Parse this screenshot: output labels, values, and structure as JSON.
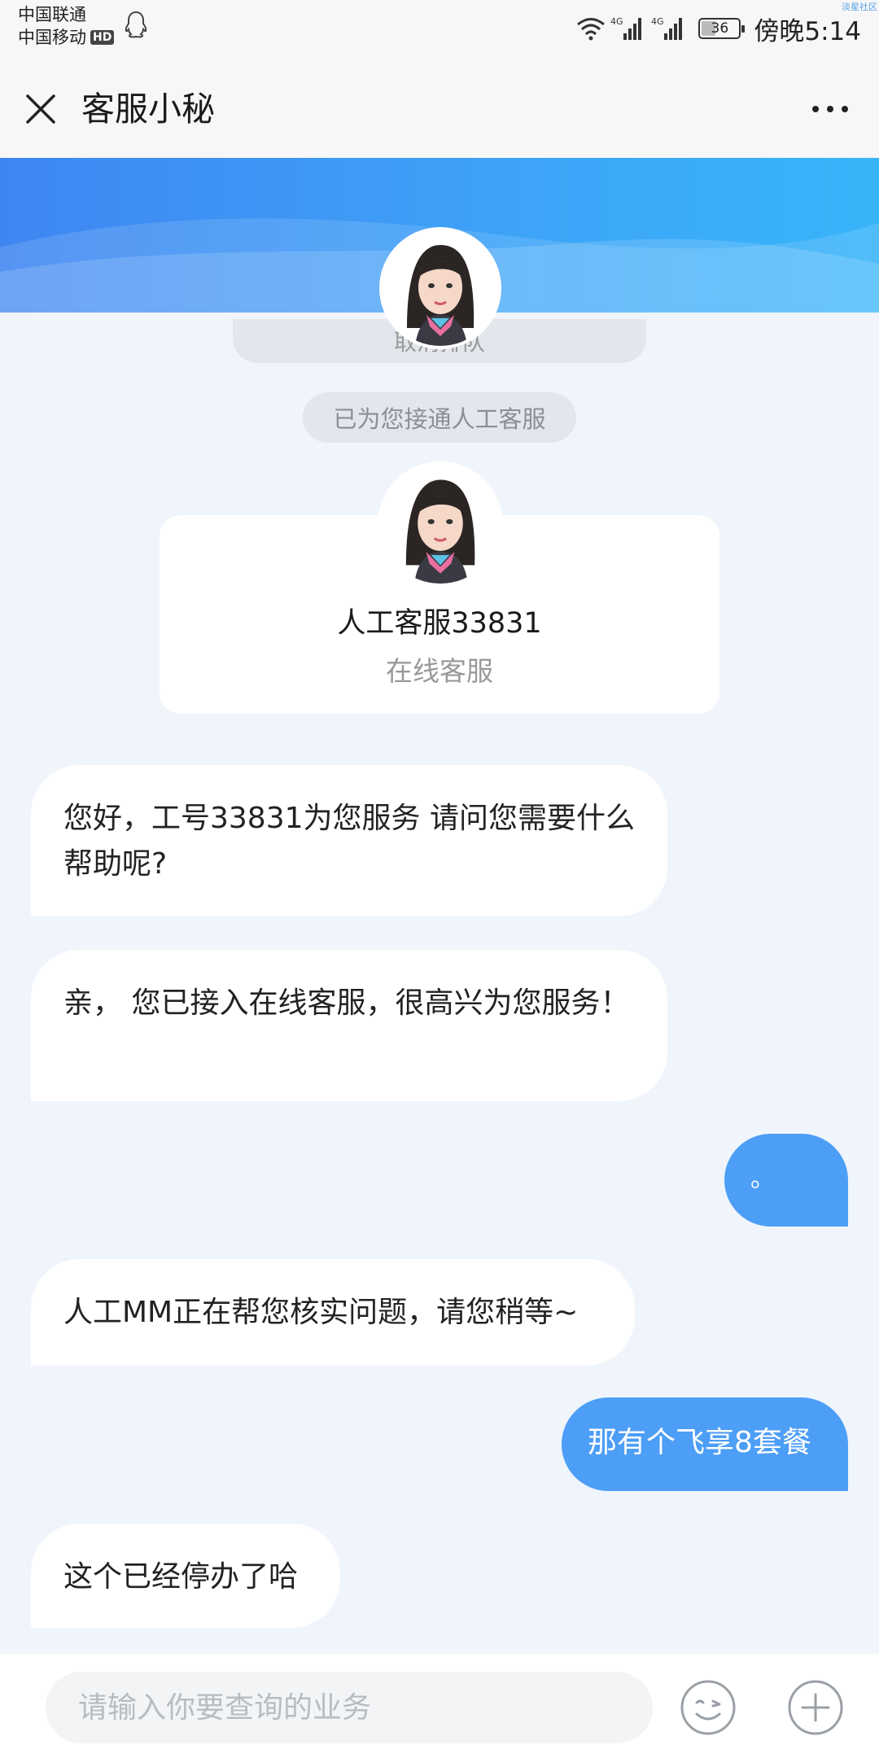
{
  "status_bar": {
    "carrier_1": "中国联通",
    "carrier_2": "中国移动",
    "hd_badge": "HD",
    "network_1": "4G",
    "network_2": "4G",
    "battery_level": "36",
    "time": "傍晚5:14",
    "watermark": "淡星社区"
  },
  "header": {
    "title": "客服小秘"
  },
  "chat": {
    "cancel_queue_label": "取消排队",
    "system_notice": "已为您接通人工客服",
    "agent": {
      "name": "人工客服33831",
      "role": "在线客服"
    },
    "messages": [
      {
        "side": "in",
        "text": "您好，工号33831为您服务 请问您需要什么帮助呢?"
      },
      {
        "side": "in",
        "text": "亲， 您已接入在线客服，很高兴为您服务！"
      },
      {
        "side": "out",
        "text": "。"
      },
      {
        "side": "in",
        "text": "人工MM正在帮您核实问题，请您稍等~"
      },
      {
        "side": "out",
        "text": "那有个飞享8套餐"
      },
      {
        "side": "in",
        "text": "这个已经停办了哈"
      }
    ]
  },
  "input_bar": {
    "placeholder": "请输入你要查询的业务",
    "value": ""
  },
  "colors": {
    "accent": "#4d9ef6",
    "banner_start": "#3f86f2",
    "banner_end": "#38b4fa",
    "chat_bg": "#f0f5fc"
  },
  "icons": [
    "close-icon",
    "more-icon",
    "qq-icon",
    "wifi-icon",
    "signal-icon",
    "battery-icon",
    "emoji-icon",
    "plus-icon"
  ]
}
